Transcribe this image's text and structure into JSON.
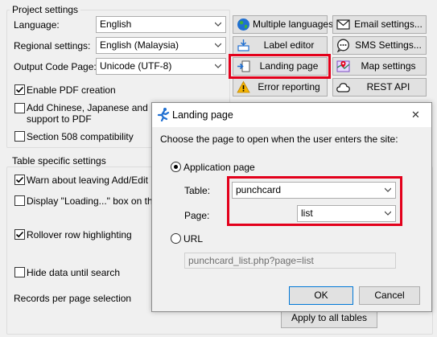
{
  "project_settings": {
    "title": "Project settings",
    "language_label": "Language:",
    "language_value": "English",
    "regional_label": "Regional settings:",
    "regional_value": "English (Malaysia)",
    "codepage_label": "Output Code Page:",
    "codepage_value": "Unicode (UTF-8)",
    "enable_pdf": {
      "label": "Enable PDF creation",
      "checked": true
    },
    "chinese_fonts": {
      "label_line1": "Add Chinese, Japanese and Kor",
      "label_line2": "support to PDF",
      "checked": false
    },
    "section508": {
      "label": "Section 508 compatibility",
      "checked": false
    }
  },
  "buttons": {
    "multiple_languages": "Multiple languages",
    "email_settings": "Email settings...",
    "label_editor": "Label editor",
    "sms_settings": "SMS Settings...",
    "landing_page": "Landing page",
    "map_settings": "Map settings",
    "error_reporting": "Error reporting",
    "rest_api": "REST API"
  },
  "table_settings": {
    "title": "Table specific settings",
    "warn_leaving": {
      "label": "Warn about leaving Add/Edit pag",
      "checked": true
    },
    "display_loading": {
      "label": "Display \"Loading...\" box on the l",
      "checked": false
    },
    "rollover": {
      "label": "Rollover row highlighting",
      "checked": true
    },
    "hide_until_search": {
      "label": "Hide data until search",
      "checked": false
    },
    "records_per_page_label": "Records per page selection",
    "apply_all": "Apply to all tables"
  },
  "dialog": {
    "title": "Landing page",
    "close_glyph": "✕",
    "prompt": "Choose the page to open when the user enters the site:",
    "application_page_label": "Application page",
    "table_label": "Table:",
    "table_value": "punchcard",
    "page_label": "Page:",
    "page_value": "list",
    "url_label": "URL",
    "url_value": "punchcard_list.php?page=list",
    "ok": "OK",
    "cancel": "Cancel",
    "selected_option": "application_page"
  },
  "colors": {
    "highlight": "#e3001b",
    "window_bg": "#f0f0f0",
    "button_bg": "#e1e1e1"
  },
  "icons": {
    "multiple_languages": "globe-icon",
    "email_settings": "email-icon",
    "label_editor": "label-editor-icon",
    "sms_settings": "sms-icon",
    "landing_page": "landing-page-icon",
    "map_settings": "map-icon",
    "error_reporting": "warning-icon",
    "rest_api": "cloud-icon",
    "dialog_app": "runner-icon"
  }
}
